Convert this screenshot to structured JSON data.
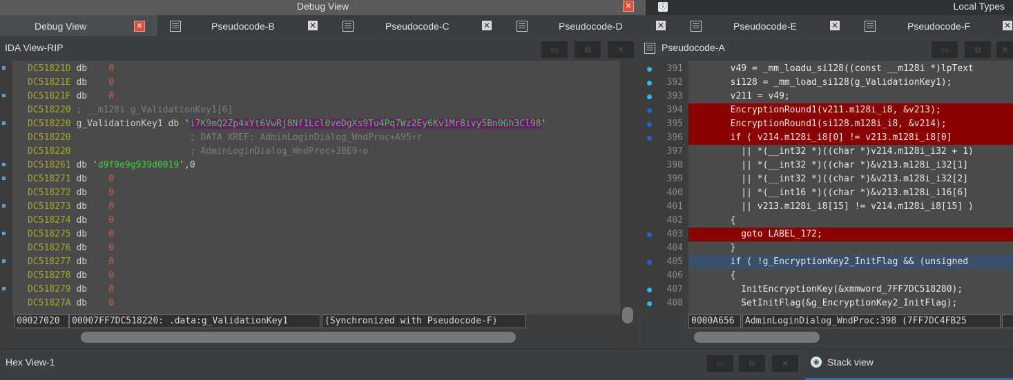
{
  "window": {
    "debug_title": "Debug View",
    "local_types_title": "Local Types"
  },
  "tabs": [
    {
      "label": "Debug View"
    },
    {
      "label": "Pseudocode-B"
    },
    {
      "label": "Pseudocode-C"
    },
    {
      "label": "Pseudocode-D"
    },
    {
      "label": "Pseudocode-E"
    },
    {
      "label": "Pseudocode-F"
    }
  ],
  "ida_view": {
    "title": "IDA View-RIP",
    "lines": [
      {
        "addr": "DC51821D",
        "text": " db    ",
        "val": "0"
      },
      {
        "addr": "DC51821E",
        "text": " db    ",
        "val": "0"
      },
      {
        "addr": "DC51821F",
        "text": " db    ",
        "val": "0"
      },
      {
        "addr": "DC518220",
        "comment": " ; __m128i g_ValidationKey1[6]"
      },
      {
        "addr": "DC518220",
        "label": " g_ValidationKey1 db '",
        "string": "i7K9mQ2Zp4xYt6VwRj8Nf1Lcl0veDgXs9Tu4Pq7Wz2Ey6Kv1Mr8ivy5Bn0Gh3Cl98",
        "tail": "'"
      },
      {
        "addr": "DC518220",
        "comment": "                      ; DATA XREF: AdminLoginDialog_WndProc+A95↑r"
      },
      {
        "addr": "DC518220",
        "comment": "                      ; AdminLoginDialog_WndProc+3BE9↑o"
      },
      {
        "addr": "DC518261",
        "label": " db '",
        "string": "d9f9e9g939d0019",
        "tail": "',0"
      },
      {
        "addr": "DC518271",
        "text": " db    ",
        "val": "0"
      },
      {
        "addr": "DC518272",
        "text": " db    ",
        "val": "0"
      },
      {
        "addr": "DC518273",
        "text": " db    ",
        "val": "0"
      },
      {
        "addr": "DC518274",
        "text": " db    ",
        "val": "0"
      },
      {
        "addr": "DC518275",
        "text": " db    ",
        "val": "0"
      },
      {
        "addr": "DC518276",
        "text": " db    ",
        "val": "0"
      },
      {
        "addr": "DC518277",
        "text": " db    ",
        "val": "0"
      },
      {
        "addr": "DC518278",
        "text": " db    ",
        "val": "0"
      },
      {
        "addr": "DC518279",
        "text": " db    ",
        "val": "0"
      },
      {
        "addr": "DC51827A",
        "text": " db    ",
        "val": "0"
      }
    ],
    "status": [
      "00027020",
      "00007FF7DC518220: .data:g_ValidationKey1",
      "(Synchronized with Pseudocode-F)"
    ]
  },
  "pseudocode": {
    "title": "Pseudocode-A",
    "lines": [
      {
        "n": "391",
        "dot": "lt",
        "code": "  v49 = _mm_loadu_si128((const __m128i *)lpText"
      },
      {
        "n": "392",
        "dot": "lt",
        "code": "  si128 = _mm_load_si128(g_ValidationKey1);"
      },
      {
        "n": "393",
        "dot": "lt",
        "code": "  v211 = v49;"
      },
      {
        "n": "394",
        "dot": "bk",
        "hl": "red",
        "code": "  EncryptionRound1(v211.m128i_i8, &v213);"
      },
      {
        "n": "395",
        "dot": "bk",
        "hl": "red",
        "code": "  EncryptionRound1(si128.m128i_i8, &v214);"
      },
      {
        "n": "396",
        "dot": "bk",
        "hl": "red",
        "code": "  if ( v214.m128i_i8[0] != v213.m128i_i8[0]"
      },
      {
        "n": "397",
        "code": "    || *(__int32 *)((char *)v214.m128i_i32 + 1)"
      },
      {
        "n": "398",
        "code": "    || *(__int32 *)((char *)&v213.m128i_i32[1]"
      },
      {
        "n": "399",
        "code": "    || *(__int32 *)((char *)&v213.m128i_i32[2]"
      },
      {
        "n": "400",
        "code": "    || *(__int16 *)((char *)&v213.m128i_i16[6]"
      },
      {
        "n": "401",
        "code": "    || v213.m128i_i8[15] != v214.m128i_i8[15] )"
      },
      {
        "n": "402",
        "code": "  {"
      },
      {
        "n": "403",
        "dot": "bk",
        "hl": "red",
        "code": "    goto LABEL_172;"
      },
      {
        "n": "404",
        "code": "  }"
      },
      {
        "n": "405",
        "dot": "bk",
        "hl": "blue",
        "code": "  if ( !g_EncryptionKey2_InitFlag && (unsigned"
      },
      {
        "n": "406",
        "code": "  {"
      },
      {
        "n": "407",
        "dot": "lt",
        "code": "    InitEncryptionKey(&xmmword_7FF7DC518280);"
      },
      {
        "n": "408",
        "dot": "lt",
        "code": "    SetInitFlag(&g_EncryptionKey2_InitFlag);"
      }
    ],
    "status": [
      "0000A656",
      "AdminLoginDialog_WndProc:398 (7FF7DC4FB25"
    ]
  },
  "bottom": {
    "hex_view": "Hex View-1",
    "stack_view": "Stack view"
  }
}
